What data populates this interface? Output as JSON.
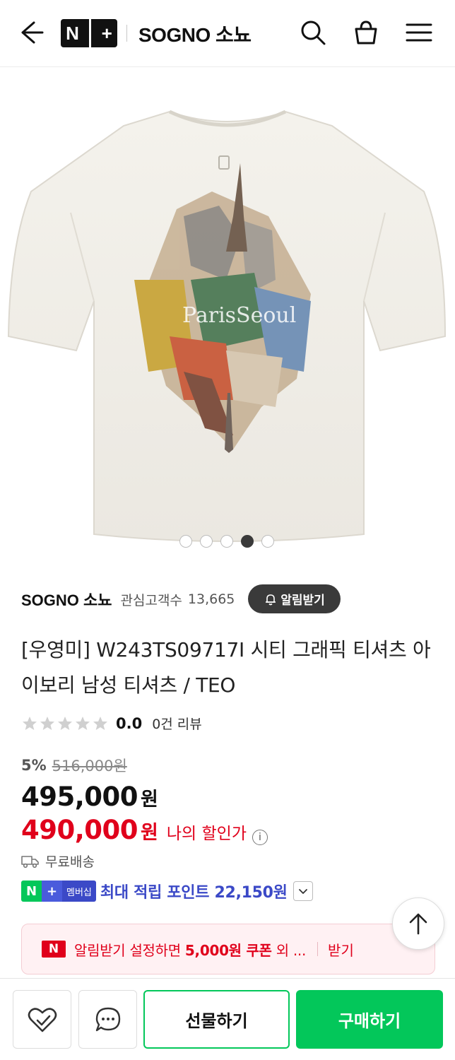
{
  "header": {
    "nplus_n": "N",
    "nplus_plus": "+",
    "store_title": "SOGNO 소뇨"
  },
  "hero": {
    "print_text": "ParisSeoul",
    "slides": 5,
    "active_slide": 4
  },
  "store": {
    "name": "SOGNO 소뇨",
    "fav_label": "관심고객수",
    "fav_count": "13,665",
    "alarm_button": "알림받기"
  },
  "product": {
    "title": "[우영미] W243TS09717I 시티 그래픽 티셔츠 아이보리 남성 티셔츠 / TEO",
    "rating_score": "0.0",
    "review_count": "0건 리뷰",
    "discount_rate": "5%",
    "original_price": "516,000원",
    "price": "495,000",
    "price_unit": "원",
    "my_price": "490,000",
    "my_price_unit": "원",
    "my_price_label": "나의 할인가",
    "info_icon_glyph": "i",
    "shipping": "무료배송"
  },
  "membership": {
    "badge_n": "N",
    "badge_plus": "+",
    "badge_label": "멤버십",
    "points_text": "최대 적립 포인트 22,150원"
  },
  "coupon": {
    "badge": "N",
    "text_prefix": "알림받기 설정하면 ",
    "text_bold": "5,000원 쿠폰",
    "text_suffix": " 외 ...",
    "action": "받기"
  },
  "bottombar": {
    "gift_label": "선물하기",
    "buy_label": "구매하기"
  },
  "colors": {
    "naver_green": "#03c75a",
    "sale_red": "#e0001b",
    "membership_blue": "#3b49c7"
  }
}
